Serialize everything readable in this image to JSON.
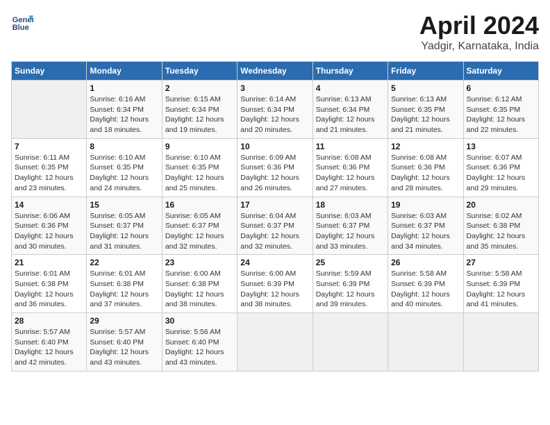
{
  "header": {
    "logo_line1": "General",
    "logo_line2": "Blue",
    "month_title": "April 2024",
    "location": "Yadgir, Karnataka, India"
  },
  "days_of_week": [
    "Sunday",
    "Monday",
    "Tuesday",
    "Wednesday",
    "Thursday",
    "Friday",
    "Saturday"
  ],
  "weeks": [
    [
      {
        "day": "",
        "info": ""
      },
      {
        "day": "1",
        "info": "Sunrise: 6:16 AM\nSunset: 6:34 PM\nDaylight: 12 hours\nand 18 minutes."
      },
      {
        "day": "2",
        "info": "Sunrise: 6:15 AM\nSunset: 6:34 PM\nDaylight: 12 hours\nand 19 minutes."
      },
      {
        "day": "3",
        "info": "Sunrise: 6:14 AM\nSunset: 6:34 PM\nDaylight: 12 hours\nand 20 minutes."
      },
      {
        "day": "4",
        "info": "Sunrise: 6:13 AM\nSunset: 6:34 PM\nDaylight: 12 hours\nand 21 minutes."
      },
      {
        "day": "5",
        "info": "Sunrise: 6:13 AM\nSunset: 6:35 PM\nDaylight: 12 hours\nand 21 minutes."
      },
      {
        "day": "6",
        "info": "Sunrise: 6:12 AM\nSunset: 6:35 PM\nDaylight: 12 hours\nand 22 minutes."
      }
    ],
    [
      {
        "day": "7",
        "info": "Sunrise: 6:11 AM\nSunset: 6:35 PM\nDaylight: 12 hours\nand 23 minutes."
      },
      {
        "day": "8",
        "info": "Sunrise: 6:10 AM\nSunset: 6:35 PM\nDaylight: 12 hours\nand 24 minutes."
      },
      {
        "day": "9",
        "info": "Sunrise: 6:10 AM\nSunset: 6:35 PM\nDaylight: 12 hours\nand 25 minutes."
      },
      {
        "day": "10",
        "info": "Sunrise: 6:09 AM\nSunset: 6:36 PM\nDaylight: 12 hours\nand 26 minutes."
      },
      {
        "day": "11",
        "info": "Sunrise: 6:08 AM\nSunset: 6:36 PM\nDaylight: 12 hours\nand 27 minutes."
      },
      {
        "day": "12",
        "info": "Sunrise: 6:08 AM\nSunset: 6:36 PM\nDaylight: 12 hours\nand 28 minutes."
      },
      {
        "day": "13",
        "info": "Sunrise: 6:07 AM\nSunset: 6:36 PM\nDaylight: 12 hours\nand 29 minutes."
      }
    ],
    [
      {
        "day": "14",
        "info": "Sunrise: 6:06 AM\nSunset: 6:36 PM\nDaylight: 12 hours\nand 30 minutes."
      },
      {
        "day": "15",
        "info": "Sunrise: 6:05 AM\nSunset: 6:37 PM\nDaylight: 12 hours\nand 31 minutes."
      },
      {
        "day": "16",
        "info": "Sunrise: 6:05 AM\nSunset: 6:37 PM\nDaylight: 12 hours\nand 32 minutes."
      },
      {
        "day": "17",
        "info": "Sunrise: 6:04 AM\nSunset: 6:37 PM\nDaylight: 12 hours\nand 32 minutes."
      },
      {
        "day": "18",
        "info": "Sunrise: 6:03 AM\nSunset: 6:37 PM\nDaylight: 12 hours\nand 33 minutes."
      },
      {
        "day": "19",
        "info": "Sunrise: 6:03 AM\nSunset: 6:37 PM\nDaylight: 12 hours\nand 34 minutes."
      },
      {
        "day": "20",
        "info": "Sunrise: 6:02 AM\nSunset: 6:38 PM\nDaylight: 12 hours\nand 35 minutes."
      }
    ],
    [
      {
        "day": "21",
        "info": "Sunrise: 6:01 AM\nSunset: 6:38 PM\nDaylight: 12 hours\nand 36 minutes."
      },
      {
        "day": "22",
        "info": "Sunrise: 6:01 AM\nSunset: 6:38 PM\nDaylight: 12 hours\nand 37 minutes."
      },
      {
        "day": "23",
        "info": "Sunrise: 6:00 AM\nSunset: 6:38 PM\nDaylight: 12 hours\nand 38 minutes."
      },
      {
        "day": "24",
        "info": "Sunrise: 6:00 AM\nSunset: 6:39 PM\nDaylight: 12 hours\nand 38 minutes."
      },
      {
        "day": "25",
        "info": "Sunrise: 5:59 AM\nSunset: 6:39 PM\nDaylight: 12 hours\nand 39 minutes."
      },
      {
        "day": "26",
        "info": "Sunrise: 5:58 AM\nSunset: 6:39 PM\nDaylight: 12 hours\nand 40 minutes."
      },
      {
        "day": "27",
        "info": "Sunrise: 5:58 AM\nSunset: 6:39 PM\nDaylight: 12 hours\nand 41 minutes."
      }
    ],
    [
      {
        "day": "28",
        "info": "Sunrise: 5:57 AM\nSunset: 6:40 PM\nDaylight: 12 hours\nand 42 minutes."
      },
      {
        "day": "29",
        "info": "Sunrise: 5:57 AM\nSunset: 6:40 PM\nDaylight: 12 hours\nand 43 minutes."
      },
      {
        "day": "30",
        "info": "Sunrise: 5:56 AM\nSunset: 6:40 PM\nDaylight: 12 hours\nand 43 minutes."
      },
      {
        "day": "",
        "info": ""
      },
      {
        "day": "",
        "info": ""
      },
      {
        "day": "",
        "info": ""
      },
      {
        "day": "",
        "info": ""
      }
    ]
  ]
}
